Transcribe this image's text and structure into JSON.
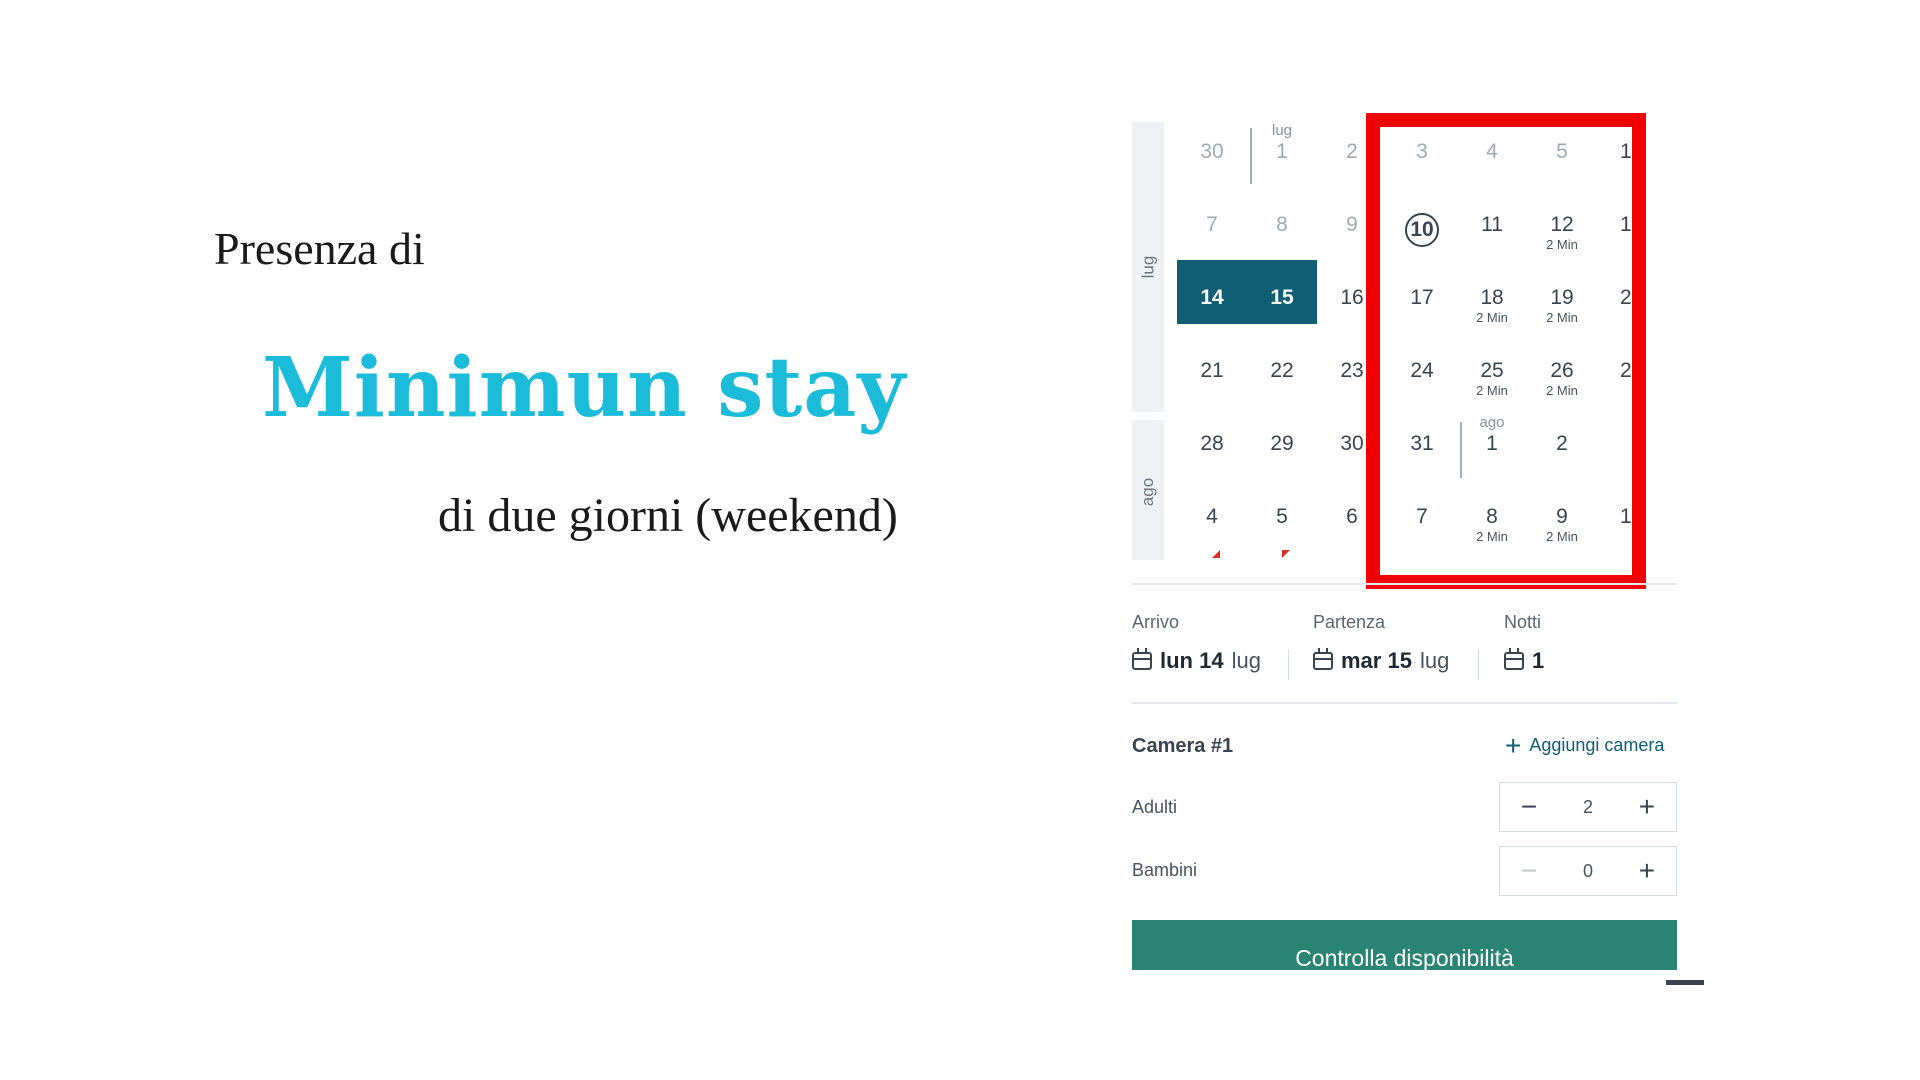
{
  "slide": {
    "intro": "Presenza di",
    "headline": "Minimun stay",
    "subline": "di due giorni (weekend)"
  },
  "calendar": {
    "month_labels": [
      "lug",
      "ago"
    ],
    "rows": [
      [
        {
          "n": "30",
          "faded": true
        },
        {
          "n": "1",
          "top": "lug",
          "faded": true
        },
        {
          "n": "2",
          "faded": true
        },
        {
          "n": "3",
          "faded": true
        },
        {
          "n": "4",
          "faded": true
        },
        {
          "n": "5",
          "faded": true
        }
      ],
      [
        {
          "n": "7",
          "faded": true
        },
        {
          "n": "8",
          "faded": true
        },
        {
          "n": "9",
          "faded": true
        },
        {
          "n": "10",
          "today": true
        },
        {
          "n": "11"
        },
        {
          "n": "12",
          "sub": "2 Min"
        }
      ],
      [
        {
          "n": "14",
          "selected": true
        },
        {
          "n": "15",
          "selected": true
        },
        {
          "n": "16"
        },
        {
          "n": "17"
        },
        {
          "n": "18",
          "sub": "2 Min"
        },
        {
          "n": "19",
          "sub": "2 Min"
        }
      ],
      [
        {
          "n": "21"
        },
        {
          "n": "22"
        },
        {
          "n": "23"
        },
        {
          "n": "24"
        },
        {
          "n": "25",
          "sub": "2 Min"
        },
        {
          "n": "26",
          "sub": "2 Min"
        }
      ],
      [
        {
          "n": "28"
        },
        {
          "n": "29"
        },
        {
          "n": "30"
        },
        {
          "n": "31"
        },
        {
          "n": "1",
          "top": "ago"
        },
        {
          "n": "2"
        }
      ],
      [
        {
          "n": "4"
        },
        {
          "n": "5"
        },
        {
          "n": "6"
        },
        {
          "n": "7"
        },
        {
          "n": "8",
          "sub": "2 Min"
        },
        {
          "n": "9",
          "sub": "2 Min"
        }
      ]
    ],
    "cut_column": [
      "1",
      "1",
      "2",
      "2",
      "",
      "1"
    ]
  },
  "booking": {
    "arrival_label": "Arrivo",
    "arrival_bold": "lun 14",
    "arrival_month": "lug",
    "departure_label": "Partenza",
    "departure_bold": "mar 15",
    "departure_month": "lug",
    "nights_label": "Notti",
    "nights_value": "1"
  },
  "room": {
    "title": "Camera #1",
    "add_label": "Aggiungi camera",
    "adults_label": "Adulti",
    "adults_value": "2",
    "children_label": "Bambini",
    "children_value": "0"
  },
  "cta_label": "Controlla disponibilità",
  "colors": {
    "accent": "#1bbcd9",
    "selected": "#0e5e74",
    "highlight": "#f00000",
    "button": "#2a8474"
  }
}
